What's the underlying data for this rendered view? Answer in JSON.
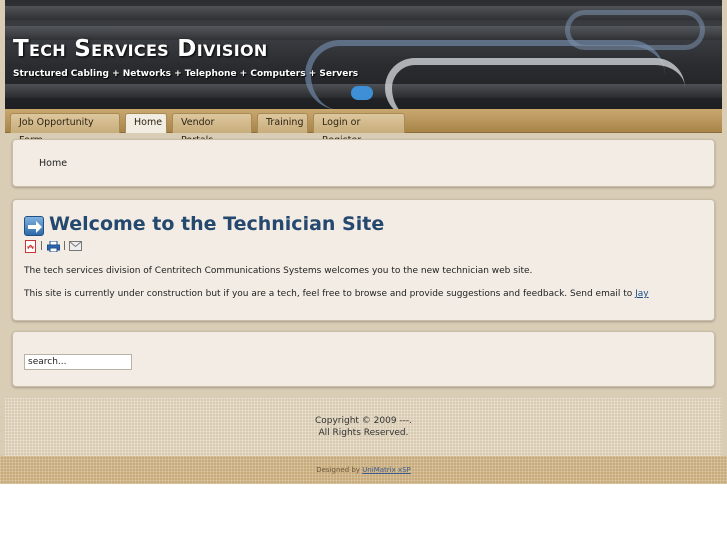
{
  "header": {
    "title": "Tech Services Division",
    "tagline": "Structured Cabling + Networks + Telephone + Computers + Servers"
  },
  "nav": {
    "items": [
      {
        "label": "Job Opportunity Form",
        "active": false
      },
      {
        "label": "Home",
        "active": true
      },
      {
        "label": "Vendor Portals",
        "active": false
      },
      {
        "label": "Training",
        "active": false
      },
      {
        "label": "Login or Register",
        "active": false
      }
    ]
  },
  "breadcrumb": "Home",
  "article": {
    "title": "Welcome to the Technician Site",
    "tools": [
      "pdf-icon",
      "print-icon",
      "email-icon"
    ],
    "separator": "|",
    "intro": "The tech services division of Centritech Communications Systems welcomes you to the new technician web site.",
    "construction": "This site is currently under construction but if you are a tech, feel free to browse and provide suggestions and feedback.  Send email to ",
    "contact_link": "Jay"
  },
  "search": {
    "value": "search..."
  },
  "footer": {
    "copyright": "Copyright © 2009 ---.",
    "rights": "All Rights Reserved.",
    "designed_prefix": "Designed by ",
    "designed_link": "UniMatrix xSP"
  },
  "colors": {
    "nav": "#b8955a",
    "title": "#24486e",
    "link": "#1b4f8a",
    "panel": "#f2ece4"
  }
}
